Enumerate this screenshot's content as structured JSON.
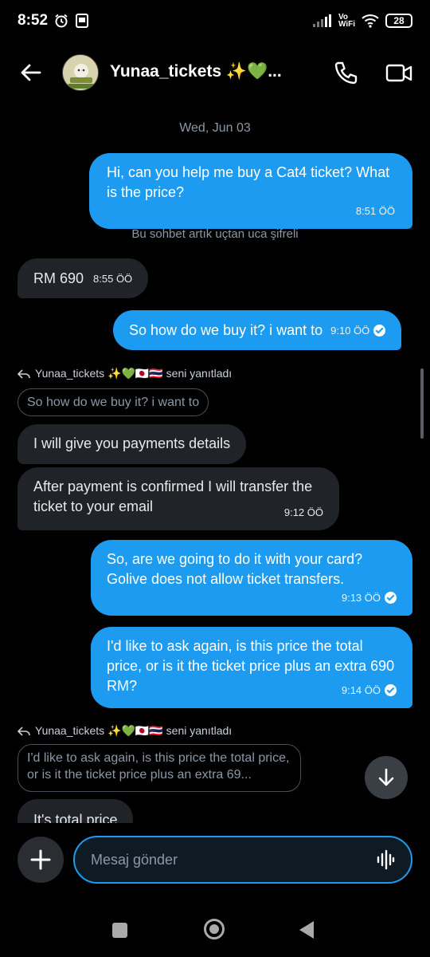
{
  "status_bar": {
    "time": "8:52",
    "vo_label": "Vo",
    "wifi_label": "WiFi",
    "battery": "28"
  },
  "header": {
    "title": "Yunaa_tickets ✨💚...",
    "back_icon": "back-arrow-icon",
    "call_icon": "phone-icon",
    "video_icon": "video-camera-icon"
  },
  "chat": {
    "date": "Wed, Jun 03",
    "encryption_note": "Bu sohbet artık uçtan uca şifreli",
    "messages": [
      {
        "dir": "out",
        "text": "Hi, can you help me buy a Cat4 ticket? What is the price?",
        "time": "8:51 ÖÖ",
        "seen": false
      },
      {
        "dir": "in",
        "text": "RM 690",
        "time": "8:55 ÖÖ"
      },
      {
        "dir": "out",
        "text": "So how do we buy it? i want to",
        "time": "9:10 ÖÖ",
        "seen": true
      },
      {
        "dir": "in",
        "text": "I will give you payments details",
        "time": ""
      },
      {
        "dir": "in",
        "text": "After payment is confirmed I will transfer the ticket to your email",
        "time": "9:12 ÖÖ"
      },
      {
        "dir": "out",
        "text": "So, are we going to do it with your card? Golive does not allow ticket transfers.",
        "time": "9:13 ÖÖ",
        "seen": true
      },
      {
        "dir": "out",
        "text": "I'd like to ask again, is this price the total price, or is it the ticket price plus an extra 690 RM?",
        "time": "9:14 ÖÖ",
        "seen": true
      },
      {
        "dir": "in",
        "text": "It's total price",
        "time": ""
      }
    ],
    "replies": [
      {
        "header": "Yunaa_tickets ✨💚🇯🇵🇹🇭 seni yanıtladı",
        "quote": "So how do we buy it? i want to"
      },
      {
        "header": "Yunaa_tickets ✨💚🇯🇵🇹🇭 seni yanıtladı",
        "quote": "I'd like to ask again, is this price the total price, or is it the ticket price plus an extra 69..."
      }
    ]
  },
  "composer": {
    "placeholder": "Mesaj gönder",
    "add_icon": "plus-icon",
    "voice_icon": "waveform-icon"
  },
  "colors": {
    "accent": "#1d9bf0",
    "incoming_bubble": "#202327",
    "background": "#000000"
  }
}
